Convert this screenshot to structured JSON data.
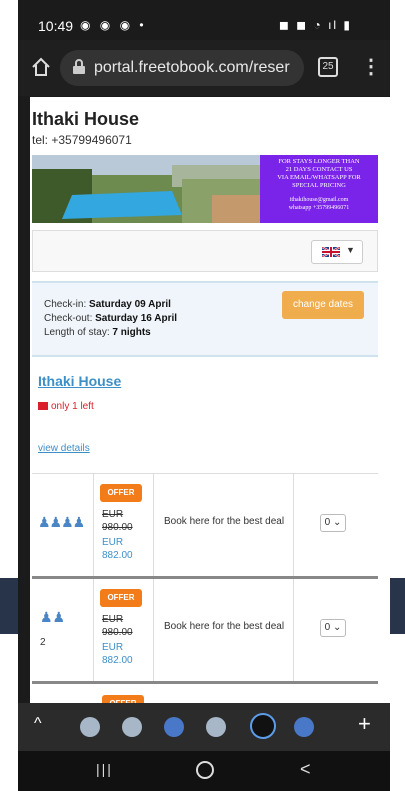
{
  "status": {
    "time": "10:49",
    "left_icons": "◉ ◉ ◉ •",
    "right_icons": "◼ ◼ ◔ ıl ▮"
  },
  "browser": {
    "url": "portal.freetobook.com/reser",
    "tab_count": "25"
  },
  "hotel": {
    "name": "Ithaki House",
    "tel": "tel: +35799496071"
  },
  "banner": {
    "line1": "FOR STAYS LONGER THAN",
    "line2": "21 DAYS CONTACT US",
    "line3": "VIA EMAIL/WHATSAPP FOR",
    "line4": "SPECIAL PRICING",
    "email": "ithakihouse@gmail.com",
    "whatsapp": "whatsapp +35799496071"
  },
  "stay": {
    "checkin_label": "Check-in:",
    "checkin_value": "Saturday 09 April",
    "checkout_label": "Check-out:",
    "checkout_value": "Saturday 16 April",
    "length_label": "Length of stay:",
    "length_value": "7 nights",
    "change_button": "change dates"
  },
  "room": {
    "name": "Ithaki House",
    "availability": "only 1 left",
    "view_details": "view details"
  },
  "rates": [
    {
      "guests_icon": "♟♟♟♟",
      "guests_num": "",
      "offer": "OFFER",
      "old_price_cur": "EUR",
      "old_price": "980.00",
      "new_price_cur": "EUR",
      "new_price": "882.00",
      "desc": "Book here for the best deal",
      "qty": "0"
    },
    {
      "guests_icon": "♟♟",
      "guests_num": "2",
      "offer": "OFFER",
      "old_price_cur": "EUR",
      "old_price": "980.00",
      "new_price_cur": "EUR",
      "new_price": "882.00",
      "desc": "Book here for the best deal",
      "qty": "0"
    }
  ],
  "peek_offer": "OFFER",
  "bubbles": {
    "up": "^",
    "plus": "+"
  },
  "nav": {
    "recents": "|||",
    "back": "<"
  },
  "colors": {
    "accent": "#3d8fc7",
    "offer": "#f27c1a",
    "change_button": "#f0ad4e",
    "banner_purple": "#7a24ea"
  }
}
